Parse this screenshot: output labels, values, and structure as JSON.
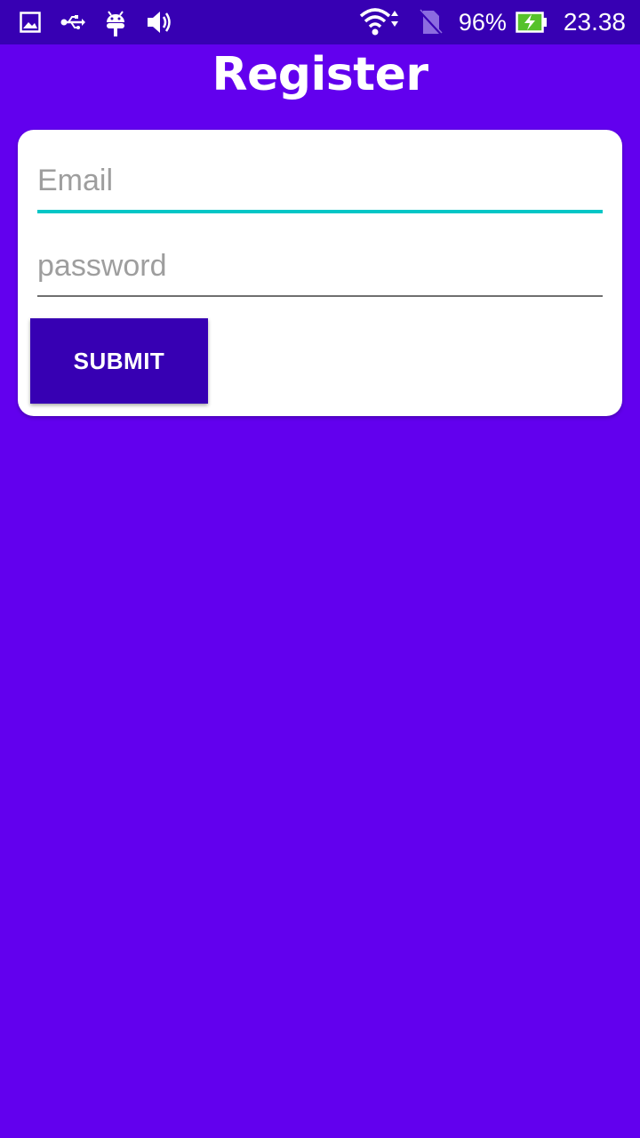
{
  "status_bar": {
    "icons_left": [
      "gallery-icon",
      "usb-icon",
      "android-debug-icon",
      "volume-icon"
    ],
    "icons_right": [
      "wifi-icon",
      "no-sim-icon",
      "battery-charging-icon"
    ],
    "battery_percent": "96%",
    "time": "23.38"
  },
  "page": {
    "title": "Register"
  },
  "form": {
    "email_placeholder": "Email",
    "password_placeholder": "password",
    "submit_label": "SUBMIT"
  },
  "colors": {
    "background": "#6200ee",
    "status_bar": "#3700b3",
    "button": "#3700b3",
    "focus_underline": "#03c6c6"
  }
}
